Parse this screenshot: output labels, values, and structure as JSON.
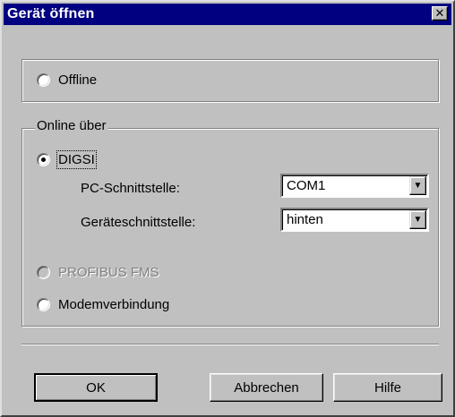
{
  "window": {
    "title": "Gerät öffnen"
  },
  "offline": {
    "label": "Offline"
  },
  "online": {
    "group_label": "Online über",
    "digsi_label": "DIGSI",
    "pc_port_label": "PC-Schnittstelle:",
    "pc_port_value": "COM1",
    "device_port_label": "Geräteschnittstelle:",
    "device_port_value": "hinten",
    "profibus_label": "PROFIBUS FMS",
    "modem_label": "Modemverbindung"
  },
  "buttons": {
    "ok": "OK",
    "cancel": "Abbrechen",
    "help": "Hilfe"
  },
  "icons": {
    "close": "close-icon",
    "dropdown": "chevron-down-icon"
  }
}
